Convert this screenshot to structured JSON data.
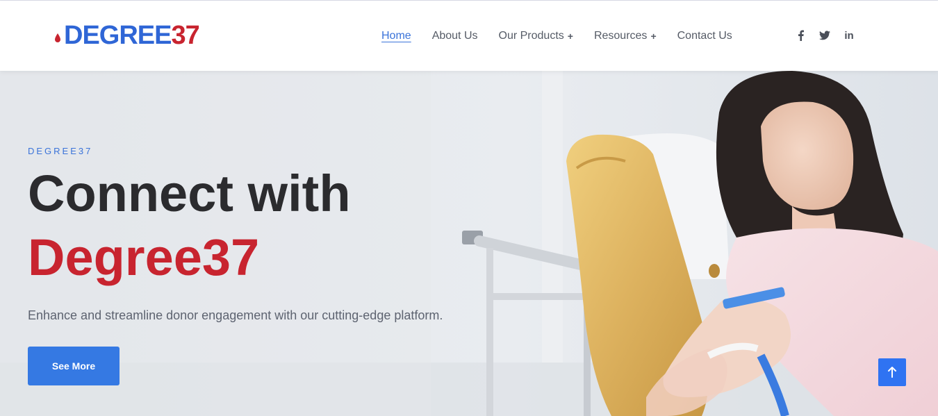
{
  "brand": {
    "logo_prefix": "DEGREE",
    "logo_suffix": "37",
    "colors": {
      "blue": "#2f66d6",
      "red": "#c8242f",
      "accent": "#3579e3"
    }
  },
  "nav": {
    "items": [
      {
        "label": "Home",
        "active": true,
        "has_submenu": false
      },
      {
        "label": "About Us",
        "active": false,
        "has_submenu": false
      },
      {
        "label": "Our Products",
        "active": false,
        "has_submenu": true
      },
      {
        "label": "Resources",
        "active": false,
        "has_submenu": true
      },
      {
        "label": "Contact Us",
        "active": false,
        "has_submenu": false
      }
    ],
    "submenu_glyph": "+"
  },
  "social": {
    "icons": [
      "facebook-icon",
      "twitter-icon",
      "linkedin-icon"
    ],
    "linkedin_text": "in"
  },
  "hero": {
    "eyebrow": "DEGREE37",
    "title_line1": "Connect with",
    "title_line2": "Degree37",
    "subtitle": "Enhance and streamline donor engagement with our cutting-edge platform.",
    "cta_label": "See More"
  },
  "scroll_top": {
    "icon": "arrow-up-icon"
  }
}
